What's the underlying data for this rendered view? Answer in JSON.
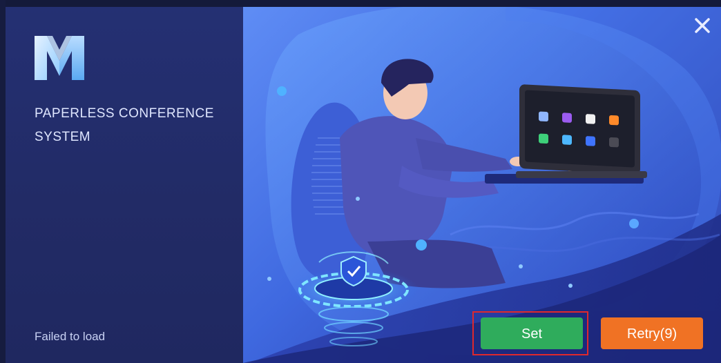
{
  "app": {
    "title_line1": "PAPERLESS CONFERENCE",
    "title_line2": "SYSTEM",
    "logo_icon": "m-logo-icon"
  },
  "status": {
    "message": "Failed to load"
  },
  "actions": {
    "set_label": "Set",
    "retry_label": "Retry(9)"
  },
  "colors": {
    "left_panel": "#232c6a",
    "set_button": "#2fac5c",
    "retry_button": "#f07224",
    "highlight": "#e0282c"
  }
}
